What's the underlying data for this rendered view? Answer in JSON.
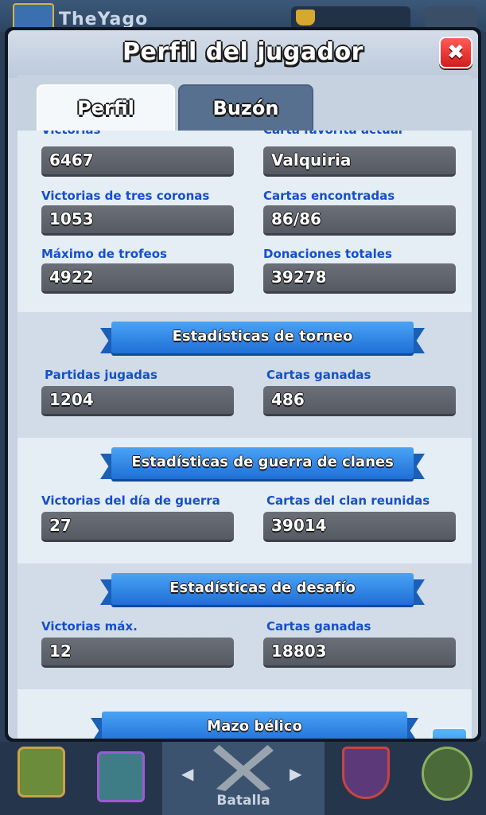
{
  "background": {
    "player_name": "TheYago"
  },
  "modal": {
    "title": "Perfil del jugador",
    "close_label": "✖"
  },
  "tabs": [
    {
      "label": "Perfil",
      "active": true
    },
    {
      "label": "Buzón",
      "active": false
    }
  ],
  "stats": {
    "top_partial": {
      "left_label": "Victorias",
      "left_value": "6467",
      "right_label": "Carta favorita actual",
      "right_value": "Valquiria"
    },
    "rows": [
      {
        "left_label": "Victorias de tres coronas",
        "left_value": "1053",
        "right_label": "Cartas encontradas",
        "right_value": "86/86"
      },
      {
        "left_label": "Máximo de trofeos",
        "left_value": "4922",
        "right_label": "Donaciones totales",
        "right_value": "39278"
      }
    ]
  },
  "sections": [
    {
      "title": "Estadísticas de torneo",
      "left_label": "Partidas jugadas",
      "left_value": "1204",
      "right_label": "Cartas ganadas",
      "right_value": "486"
    },
    {
      "title": "Estadísticas de guerra de clanes",
      "left_label": "Victorias del día de guerra",
      "left_value": "27",
      "right_label": "Cartas del clan reunidas",
      "right_value": "39014"
    },
    {
      "title": "Estadísticas de desafío",
      "left_label": "Victorias máx.",
      "left_value": "12",
      "right_label": "Cartas ganadas",
      "right_value": "18803"
    }
  ],
  "war_deck": {
    "title": "Mazo bélico",
    "arrow_icon": "↘"
  },
  "bottom_nav": {
    "battle_label": "Batalla",
    "left_arrow": "◀",
    "right_arrow": "▶"
  },
  "colors": {
    "label_blue": "#1550c9",
    "ribbon_blue": "#2f86e8",
    "close_red": "#e43232",
    "field_gray": "#60646d"
  }
}
